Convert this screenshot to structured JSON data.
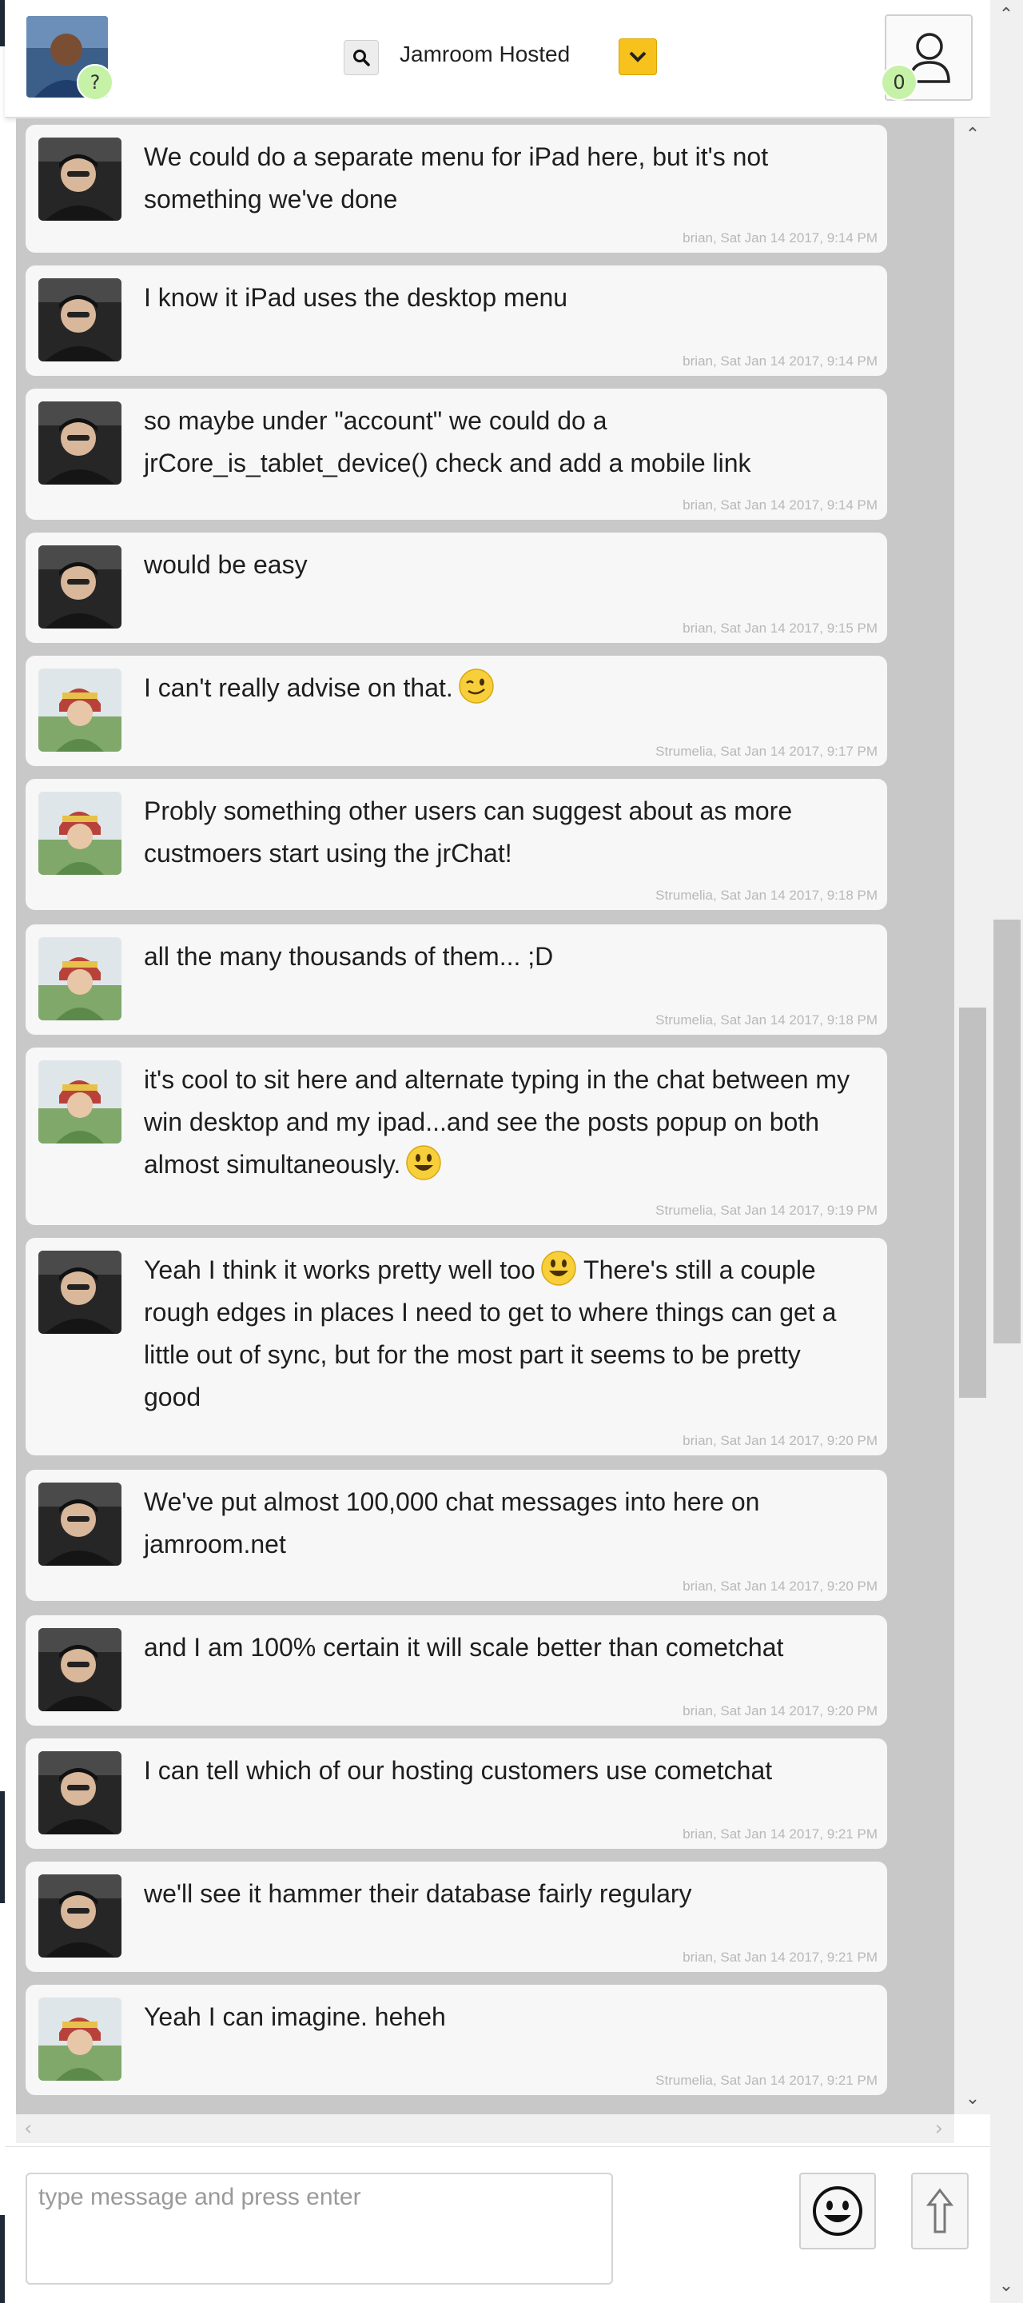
{
  "header": {
    "room_name": "Jamroom Hosted",
    "profile_badge": "?",
    "users_online_count": "0"
  },
  "messages": [
    {
      "author": "brian",
      "text": "We could do a separate menu for iPad here, but it's not something we've done",
      "meta": "brian, Sat Jan 14 2017, 9:14 PM"
    },
    {
      "author": "brian",
      "text": "I know it iPad uses the desktop menu",
      "meta": "brian, Sat Jan 14 2017, 9:14 PM"
    },
    {
      "author": "brian",
      "text": "so maybe under \"account\" we could do a jrCore_is_tablet_device() check and add a mobile link",
      "meta": "brian, Sat Jan 14 2017, 9:14 PM"
    },
    {
      "author": "brian",
      "text": "would be easy",
      "meta": "brian, Sat Jan 14 2017, 9:15 PM"
    },
    {
      "author": "Strumelia",
      "text": "I can't really advise on that.",
      "emoji": "wink",
      "meta": "Strumelia, Sat Jan 14 2017, 9:17 PM"
    },
    {
      "author": "Strumelia",
      "text": "Probly something other users can suggest about as more custmoers start using the jrChat!",
      "meta": "Strumelia, Sat Jan 14 2017, 9:18 PM"
    },
    {
      "author": "Strumelia",
      "text": "all the many thousands of them... ;D",
      "meta": "Strumelia, Sat Jan 14 2017, 9:18 PM"
    },
    {
      "author": "Strumelia",
      "text": "it's cool to sit here and alternate typing in the chat between my win desktop and my ipad...and see the posts popup on both almost simultaneously.",
      "emoji": "grin",
      "meta": "Strumelia, Sat Jan 14 2017, 9:19 PM"
    },
    {
      "author": "brian",
      "text_before": "Yeah I think it works pretty well too",
      "emoji": "grin",
      "text_after": " There's still a couple rough edges in places I need to get to where things can get a little out of sync, but for the most part it seems to be pretty good",
      "meta": "brian, Sat Jan 14 2017, 9:20 PM"
    },
    {
      "author": "brian",
      "text": "We've put almost 100,000 chat messages into here on jamroom.net",
      "meta": "brian, Sat Jan 14 2017, 9:20 PM"
    },
    {
      "author": "brian",
      "text": "and I am 100% certain it will scale better than cometchat",
      "meta": "brian, Sat Jan 14 2017, 9:20 PM"
    },
    {
      "author": "brian",
      "text": "I can tell which of our hosting customers use cometchat",
      "meta": "brian, Sat Jan 14 2017, 9:21 PM"
    },
    {
      "author": "brian",
      "text": "we'll see it hammer their database fairly regulary",
      "meta": "brian, Sat Jan 14 2017, 9:21 PM"
    },
    {
      "author": "Strumelia",
      "text": "Yeah I can imagine. heheh",
      "meta": "Strumelia, Sat Jan 14 2017, 9:21 PM"
    }
  ],
  "composer": {
    "placeholder": "type message and press enter"
  },
  "colors": {
    "accent_yellow": "#f7c21b",
    "badge_green": "#c6f2a8",
    "message_bg": "#f7f7f7",
    "list_bg": "#c8c8c8"
  }
}
